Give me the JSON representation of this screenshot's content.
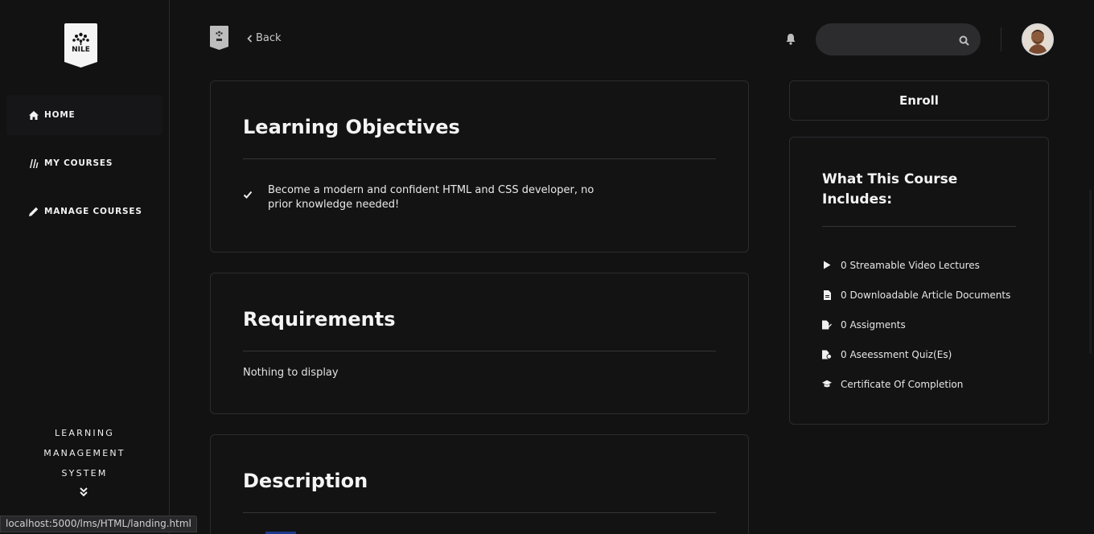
{
  "sidebar": {
    "logo_text": "NILE",
    "items": [
      {
        "label": "HOME",
        "icon": "home-icon"
      },
      {
        "label": "MY COURSES",
        "icon": "books-icon"
      },
      {
        "label": "MANAGE COURSES",
        "icon": "pencil-icon"
      }
    ],
    "caption": [
      "LEARNING",
      "MANAGEMENT",
      "SYSTEM"
    ]
  },
  "header": {
    "back_label": "Back",
    "search": {
      "value": "",
      "placeholder": ""
    }
  },
  "objectives": {
    "title": "Learning Objectives",
    "items": [
      "Become a modern and confident HTML and CSS developer, no prior knowledge needed!"
    ]
  },
  "requirements": {
    "title": "Requirements",
    "empty_text": "Nothing to display"
  },
  "description": {
    "title": "Description"
  },
  "enroll": {
    "label": "Enroll"
  },
  "includes": {
    "title": "What This Course Includes:",
    "items": [
      {
        "label": "0 Streamable Video Lectures",
        "icon": "play-icon"
      },
      {
        "label": "0 Downloadable Article Documents",
        "icon": "document-icon"
      },
      {
        "label": "0 Assigments",
        "icon": "assignment-icon"
      },
      {
        "label": "0 Aseessment Quiz(Es)",
        "icon": "quiz-icon"
      },
      {
        "label": "Certificate Of Completion",
        "icon": "graduation-cap-icon"
      }
    ]
  },
  "status_bar": {
    "url": "localhost:5000/lms/HTML/landing.html"
  },
  "colors": {
    "background": "#121213",
    "card_border": "#2c2c2e",
    "accent_blue": "#1e3a8a"
  }
}
